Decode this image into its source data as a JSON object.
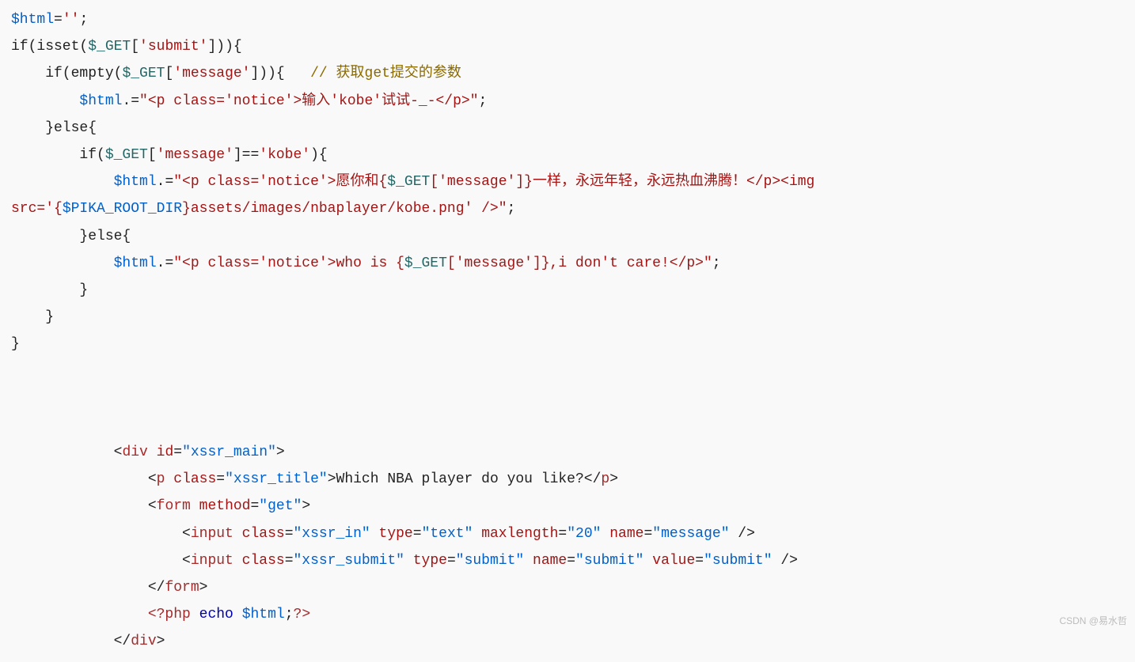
{
  "code": {
    "l1_var": "$html",
    "l1_eq": "=",
    "l1_str": "''",
    "l1_semi": ";",
    "l2_pre": "if(isset(",
    "l2_sg": "$_GET",
    "l2_mid": "[",
    "l2_key": "'submit'",
    "l2_end": "])){",
    "l3_pre": "    if(empty(",
    "l3_sg": "$_GET",
    "l3_mid": "[",
    "l3_key": "'message'",
    "l3_end": "])){   ",
    "l3_comment": "// 获取get提交的参数",
    "l4_pre": "        ",
    "l4_var": "$html",
    "l4_op": ".=",
    "l4_str": "\"<p class='notice'>输入'kobe'试试-_-</p>\"",
    "l4_semi": ";",
    "l5": "    }else{",
    "l6_pre": "        if(",
    "l6_sg": "$_GET",
    "l6_mid": "[",
    "l6_key": "'message'",
    "l6_end": "]==",
    "l6_val": "'kobe'",
    "l6_close": "){",
    "l7_pre": "            ",
    "l7_var": "$html",
    "l7_op": ".=",
    "l7_s1": "\"<p class='notice'>愿你和{",
    "l7_sg": "$_GET",
    "l7_mid": "[",
    "l7_key": "'message'",
    "l7_s2": "]}一样，永远年轻，永远热血沸腾！</p><img ",
    "l7b_s1": "src='{",
    "l7b_var": "$PIKA_ROOT_DIR",
    "l7b_s2": "}assets/images/nbaplayer/kobe.png' />\"",
    "l7b_semi": ";",
    "l8": "        }else{",
    "l9_pre": "            ",
    "l9_var": "$html",
    "l9_op": ".=",
    "l9_s1": "\"<p class='notice'>who is {",
    "l9_sg": "$_GET",
    "l9_mid": "[",
    "l9_key": "'message'",
    "l9_s2": "]},i don't care!</p>\"",
    "l9_semi": ";",
    "l10": "        }",
    "l11": "    }",
    "l12": "}",
    "h1_pre": "            <",
    "h1_tag": "div",
    "h1_sp": " ",
    "h1_attr": "id",
    "h1_eq": "=",
    "h1_val": "\"xssr_main\"",
    "h1_close": ">",
    "h2_pre": "                <",
    "h2_tag": "p",
    "h2_sp": " ",
    "h2_attr": "class",
    "h2_eq": "=",
    "h2_val": "\"xssr_title\"",
    "h2_close": ">",
    "h2_text": "Which NBA player do you like?",
    "h2_ct": "</",
    "h2_ctag": "p",
    "h2_cclose": ">",
    "h3_pre": "                <",
    "h3_tag": "form",
    "h3_sp": " ",
    "h3_attr": "method",
    "h3_eq": "=",
    "h3_val": "\"get\"",
    "h3_close": ">",
    "h4_pre": "                    <",
    "h4_tag": "input",
    "h4_sp": " ",
    "h4_a1": "class",
    "h4_e1": "=",
    "h4_v1": "\"xssr_in\"",
    "h4_a2": "type",
    "h4_e2": "=",
    "h4_v2": "\"text\"",
    "h4_a3": "maxlength",
    "h4_e3": "=",
    "h4_v3": "\"20\"",
    "h4_a4": "name",
    "h4_e4": "=",
    "h4_v4": "\"message\"",
    "h4_close": " />",
    "h5_pre": "                    <",
    "h5_tag": "input",
    "h5_sp": " ",
    "h5_a1": "class",
    "h5_e1": "=",
    "h5_v1": "\"xssr_submit\"",
    "h5_a2": "type",
    "h5_e2": "=",
    "h5_v2": "\"submit\"",
    "h5_a3": "name",
    "h5_e3": "=",
    "h5_v3": "\"submit\"",
    "h5_a4": "value",
    "h5_e4": "=",
    "h5_v4": "\"submit\"",
    "h5_close": " />",
    "h6_pre": "                </",
    "h6_tag": "form",
    "h6_close": ">",
    "h7_pre": "                ",
    "h7_open": "<?php",
    "h7_sp": " ",
    "h7_echo": "echo",
    "h7_var": "$html",
    "h7_semi": ";",
    "h7_close": "?>",
    "h8_pre": "            </",
    "h8_tag": "div",
    "h8_close": ">"
  },
  "watermark": "CSDN @易水哲"
}
